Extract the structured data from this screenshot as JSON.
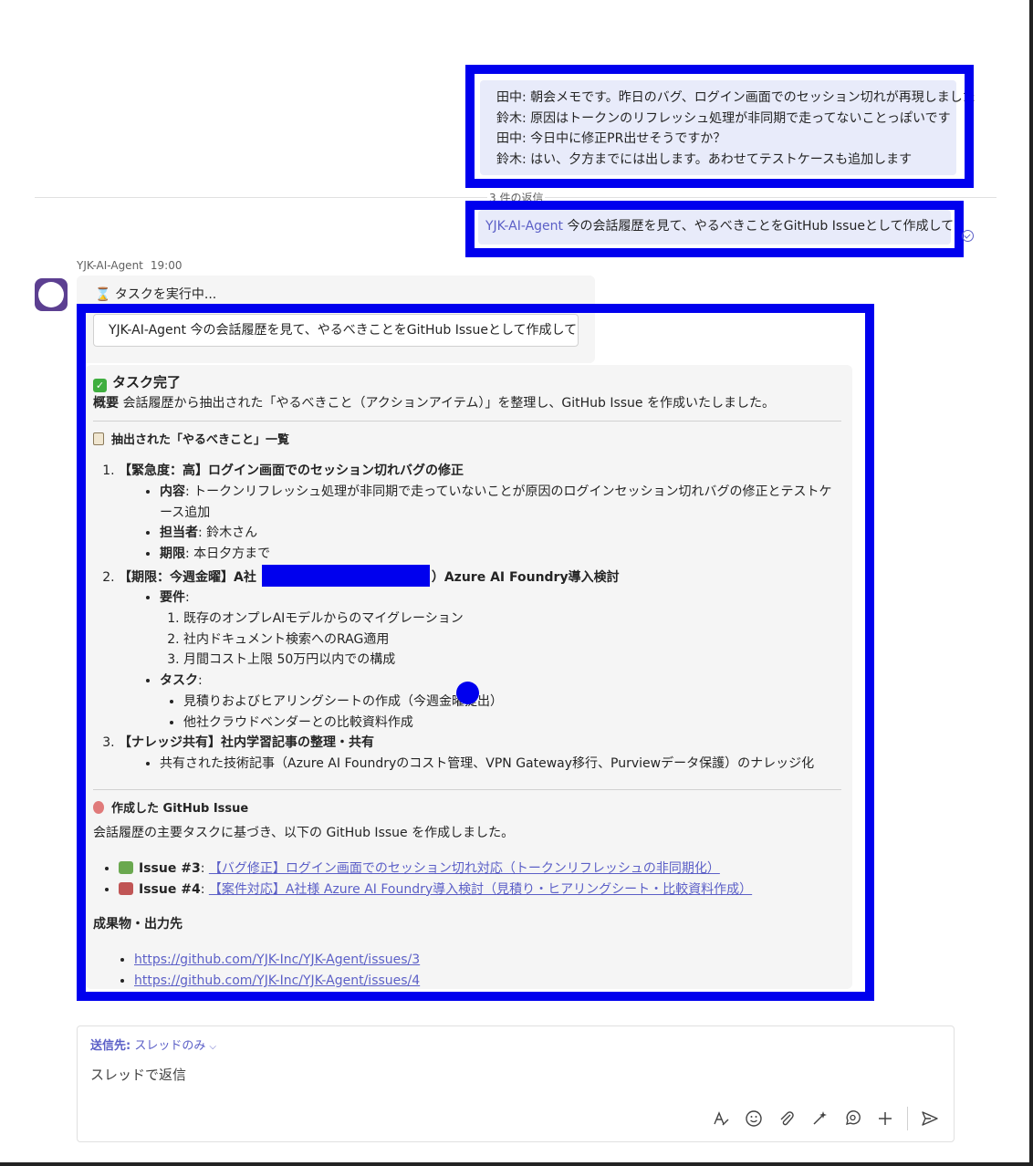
{
  "thread": {
    "user_message": {
      "lines": [
        "田中: 朝会メモです。昨日のバグ、ログイン画面でのセッション切れが再現しました",
        "鈴木: 原因はトークンのリフレッシュ処理が非同期で走ってないことっぽいです",
        "田中: 今日中に修正PR出せそうですか？",
        "鈴木: はい、夕方までには出します。あわせてテストケースも追加します"
      ]
    },
    "replies_label": "3 件の返信",
    "reply": {
      "mention": "YJK-AI-Agent",
      "text": " 今の会話履歴を見て、やるべきことをGitHub Issueとして作成して"
    }
  },
  "agent": {
    "name": "YJK-AI-Agent",
    "time": "19:00",
    "running_text": "⌛ タスクを実行中...",
    "quoted_request": "YJK-AI-Agent 今の会話履歴を見て、やるべきことをGitHub Issueとして作成して"
  },
  "result": {
    "done_title": "タスク完了",
    "summary_label": "概要",
    "summary_text": " 会話履歴から抽出された「やるべきこと（アクションアイテム）」を整理し、GitHub Issue を作成いたしました。",
    "extracted_head": "抽出された「やるべきこと」一覧",
    "item1": {
      "title": "【緊急度：高】ログイン画面でのセッション切れバグの修正",
      "content_label": "内容",
      "content_text": ": トークンリフレッシュ処理が非同期で走っていないことが原因のログインセッション切れバグの修正とテストケース追加",
      "assignee_label": "担当者",
      "assignee_text": ": 鈴木さん",
      "deadline_label": "期限",
      "deadline_text": ": 本日夕方まで"
    },
    "item2": {
      "title_prefix": "【期限：今週金曜】A社",
      "title_suffix": "）Azure AI Foundry導入検討",
      "req_label": "要件",
      "reqs": [
        "既存のオンプレAIモデルからのマイグレーション",
        "社内ドキュメント検索へのRAG適用",
        "月間コスト上限 50万円以内での構成"
      ],
      "task_label": "タスク",
      "tasks": [
        "見積りおよびヒアリングシートの作成（今週金曜提出）",
        "他社クラウドベンダーとの比較資料作成"
      ]
    },
    "item3": {
      "title": "【ナレッジ共有】社内学習記事の整理・共有",
      "text": "共有された技術記事（Azure AI Foundryのコスト管理、VPN Gateway移行、Purviewデータ保護）のナレッジ化"
    },
    "issues_head": "作成した GitHub Issue",
    "issues_intro": "会話履歴の主要タスクに基づき、以下の GitHub Issue を作成しました。",
    "issues": [
      {
        "label": "Issue #3",
        "title": "【バグ修正】ログイン画面でのセッション切れ対応（トークンリフレッシュの非同期化）"
      },
      {
        "label": "Issue #4",
        "title": "【案件対応】A社様 Azure AI Foundry導入検討（見積り・ヒアリングシート・比較資料作成）"
      }
    ],
    "outputs_head": "成果物・出力先",
    "outputs": [
      "https://github.com/YJK-Inc/YJK-Agent/issues/3",
      "https://github.com/YJK-Inc/YJK-Agent/issues/4"
    ]
  },
  "compose": {
    "to_label": "送信先:",
    "to_value": "スレッドのみ",
    "placeholder": "スレッドで返信"
  },
  "colors": {
    "highlight": "#0000ee",
    "accent": "#5b5fc7",
    "bubble": "#e8ebfa",
    "avatar": "#5c3f91"
  }
}
